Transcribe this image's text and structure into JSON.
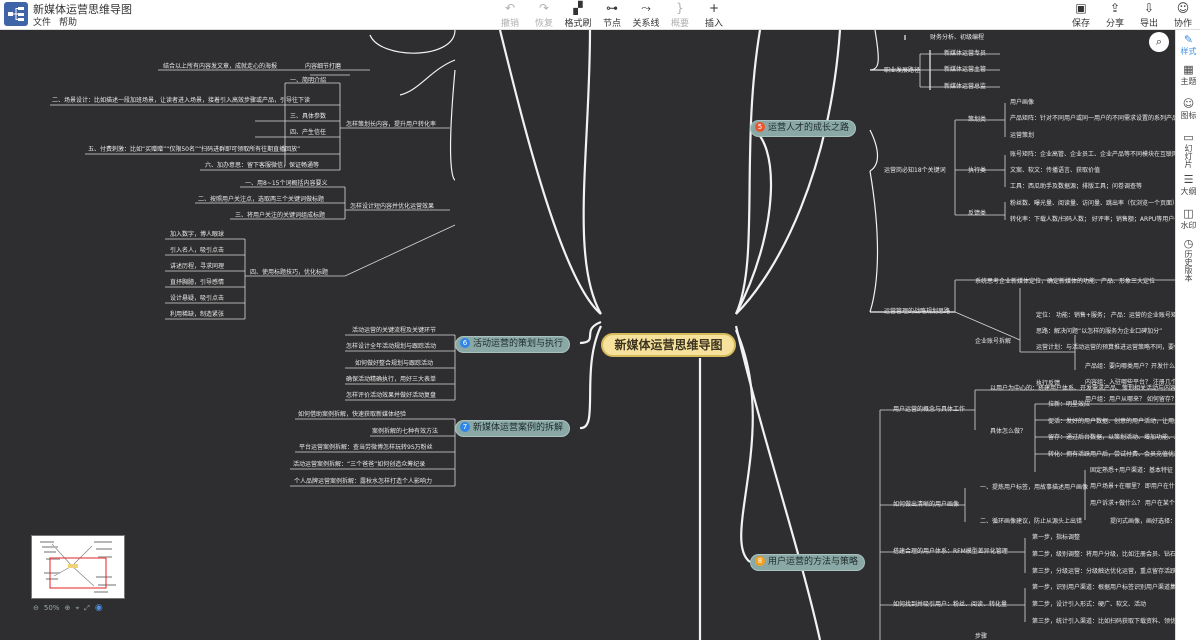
{
  "app": {
    "title": "新媒体运营思维导图",
    "menu": [
      "文件",
      "帮助"
    ]
  },
  "toolbar": {
    "undo": "撤销",
    "redo": "恢复",
    "format_brush": "格式刷",
    "node": "节点",
    "relation": "关系线",
    "summary": "概要",
    "insert": "插入",
    "save": "保存",
    "share": "分享",
    "export": "导出",
    "collab": "协作"
  },
  "side_panel": {
    "style": "样式",
    "theme": "主题",
    "icon": "图标",
    "slides": "幻灯片",
    "outline": "大纲",
    "watermark": "水印",
    "history": "历史版本"
  },
  "mindmap": {
    "root": "新媒体运营思维导图",
    "branches": {
      "b5": {
        "num": "5",
        "label": "运营人才的成长之路",
        "color": "#e8572f"
      },
      "b6": {
        "num": "6",
        "label": "活动运营的策划与执行",
        "color": "#2f86e8"
      },
      "b7": {
        "num": "7",
        "label": "新媒体运营案例的拆解",
        "color": "#2f86e8"
      },
      "b8": {
        "num": "8",
        "label": "用户运营的方法与策略",
        "color": "#f0a020"
      }
    },
    "left_top": {
      "l0": "结合以上所有内容发文章，成就走心的海报",
      "l0b": "内容细节打磨",
      "g1": "怎样策划长内容，提升用户转化率",
      "g1_items": [
        "一、简明介绍",
        "二、场景设计：比如描述一段加班场景，让读者进入场景，接着引入高效步骤或产品，引导往下读",
        "三、具体参数",
        "四、产生信任",
        "五、付费刺激：比如“买赠赠”“仅限50名”“扫码进群即可领取所有往期直播回放”",
        "六、加办意思：留下客服微信，保证畅通等"
      ],
      "g2": "怎样设计短内容并优化运营效果",
      "g2_items": [
        "一、用8~15个词概括内容要义",
        "二、按照用户关注点，选取两三个关键词做标题",
        "三、将用户关注的关键词组成标题"
      ],
      "g3": "四、使用标题技巧，优化标题",
      "g3_items": [
        "加入数字，博人眼球",
        "引入名人，吸引点击",
        "讲述历程，寻求同理",
        "直抒胸臆，引导感情",
        "设计悬疑，吸引点击",
        "利用稀缺，制造紧张"
      ]
    },
    "b6_items": [
      "活动运营的关键流程及关键环节",
      "怎样设计全年活动规划与跟踪活动",
      "如何做好整合规划与跟踪活动",
      "确保活动精确执行，用好三大表单",
      "怎样评价活动效果并做好活动复盘"
    ],
    "b7_items": [
      "如何借助案例拆解，快速获取新媒体经验",
      "案例拆解的七种有效方法",
      "平台运营案例拆解：查当劳微博怎样玩转9S万粉丝",
      "活动运营案例拆解：“三个爸爸”如何创造众筹纪录",
      "个人品牌运营案例拆解：露秋水怎样打造个人影响力"
    ],
    "b5": {
      "top_items": [
        "财务分析、初级编程"
      ],
      "career": "职业发展路径",
      "career_items": [
        "新媒体运营专员",
        "新媒体运营主管",
        "新媒体运营总监"
      ],
      "skills": "运营岗必知18个关键词",
      "cat_plan": "策划类",
      "plan_items": [
        "用户画像",
        "产品矩阵：针对不同用户或同一用户的不同需求设置的系列产品",
        "运营策划"
      ],
      "cat_exec": "执行类",
      "exec_items": [
        "账号矩阵：企业高管、企业员工、企业产品等不同模块在互联网的账号集群",
        "文案、软文：传播语言、获取价值",
        "工具：西瓜助手及数据源；排版工具；问卷调查等"
      ],
      "cat_fb": "反馈类",
      "fb_items": [
        "粉丝数、曝光量、阅读量、访问量、跳出率（仅浏览一个页面）",
        "转化率：下载人数/扫码人数； 好评率；销售额；ARPU等用户平均收入"
      ],
      "strategy": "运营管理的战略规划思路",
      "strategy_items": [
        "系统思考企业新媒体定位，确定新媒体的功能、产品、形象三大定位"
      ],
      "account": "企业账号拆解",
      "account_items": [
        "定位： 功能：销售+服务； 产品：运营的企业账号矩阵；",
        "思路：解决问题“以怎样的服务为企业口碑加分”",
        "运营计划：与活动运营的预算推进运营策略不同，要做好年度规划"
      ],
      "feedback": "执行反馈",
      "feedback_items": [
        "产品组：要向哪类用户？开发什么产品？",
        "内容组：入驻哪些平台？ 注册几个账号？",
        "用户组：用户从哪来？ 如何留存？如何激活"
      ]
    },
    "b8": {
      "concept": "用户运营的概念与具体工作",
      "concept_items": [
        "以用户为中心的：搭建用户体系、开发需求产品、策划相关活动与内容"
      ],
      "how": "具体怎么做？",
      "how_items": [
        "拉新：明星效应",
        "促活：发好的用户数据、创意的用户活动，让用户感到兴趣",
        "留存：通过后台数据，以策划活动、增加功能、发福利等方式留存用户",
        "转化：拥有活跃用户后，尝试付费、会员充值优惠等到达转化"
      ],
      "persona": "如何做出清晰的用户画像",
      "persona_a": "一、提炼用户标签，用故事描述用户画像",
      "persona_a_items": [
        "固定熟悉+用户渠道：基本特征",
        "用户场景+在哪里？ 即用户在什么情况下",
        "用户诉求+做什么？ 用户在某个场景下想做什么"
      ],
      "persona_b": "二、循环画像建议，防止从源头上出错",
      "persona_b_items": [
        "提问式画像，画好选择：大数据说明"
      ],
      "rfm": "搭建合理的用户体系：RFM模型差异化管理",
      "rfm_items": [
        "第一步，指标调整",
        "第二步，级别调整：将用户分级，比如注册会员、钻石会员、铂金会员",
        "第三步，分级运营：分级触达优化运营，重点留存活跃度差、消费水平高的用户"
      ],
      "acq": "如何找到并吸引用户：粉丝、阅读、转化量",
      "acq_items": [
        "第一步，识别用户渠道：根据用户标签识别用户渠道集中地",
        "第二步，设计引入形式：硬广、软文、活动",
        "第三步，统计引入渠道：比如扫码获取下载资料、领优惠券门槛"
      ],
      "more": "步骤"
    }
  },
  "canvas": {
    "zoom": "50%"
  }
}
